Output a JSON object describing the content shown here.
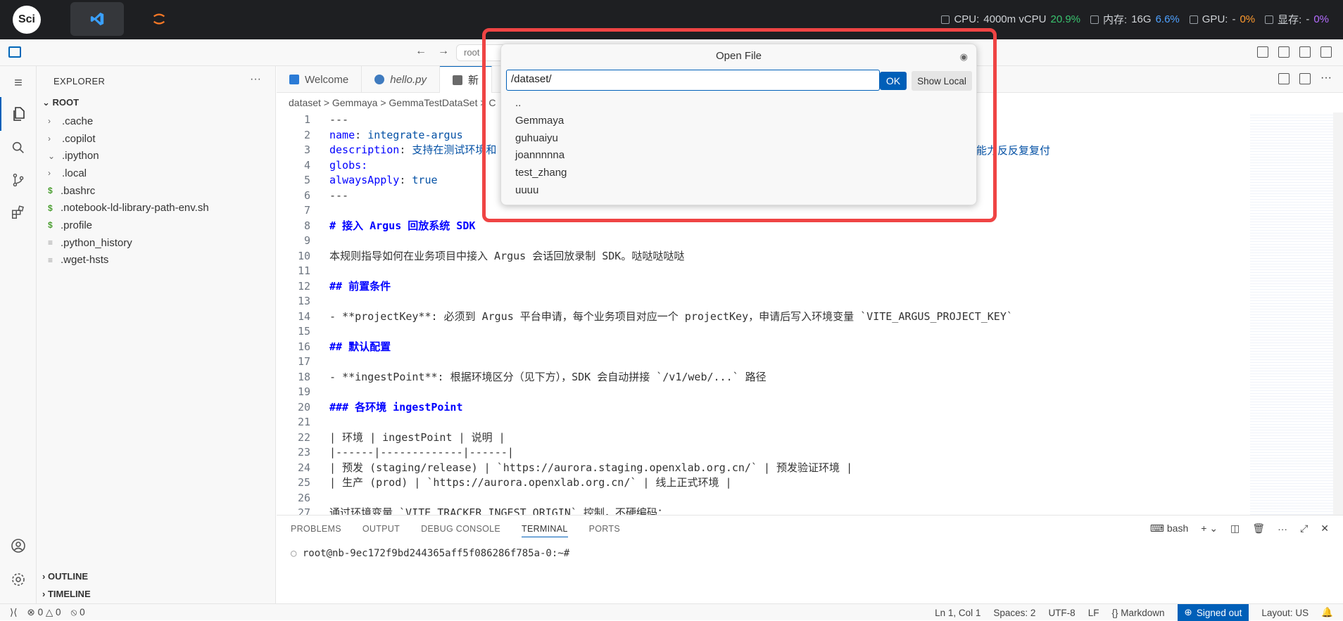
{
  "topbar": {
    "logo_text": "Sci",
    "stats": {
      "cpu_label": "CPU:",
      "cpu_value": "4000m vCPU",
      "cpu_percent": "20.9%",
      "mem_label": "内存:",
      "mem_value": "16G",
      "mem_percent": "6.6%",
      "gpu_label": "GPU:",
      "gpu_value": "-",
      "gpu_percent": "0%",
      "vram_label": "显存:",
      "vram_value": "-",
      "vram_percent": "0%"
    },
    "colors": {
      "green": "#39c26e",
      "blue": "#4ea1ff",
      "orange": "#ff9a2e",
      "purple": "#b46cff"
    }
  },
  "titlebar": {
    "command_center": "root"
  },
  "sidebar": {
    "title": "EXPLORER",
    "root": "ROOT",
    "items": [
      {
        "label": ".cache",
        "type": "folder",
        "twisty": "›"
      },
      {
        "label": ".copilot",
        "type": "folder",
        "twisty": "›"
      },
      {
        "label": ".ipython",
        "type": "folder",
        "twisty": "⌄"
      },
      {
        "label": ".local",
        "type": "folder",
        "twisty": "›"
      },
      {
        "label": ".bashrc",
        "type": "shell",
        "icon": "$"
      },
      {
        "label": ".notebook-ld-library-path-env.sh",
        "type": "shell",
        "icon": "$"
      },
      {
        "label": ".profile",
        "type": "shell",
        "icon": "$"
      },
      {
        "label": ".python_history",
        "type": "text",
        "icon": "≡"
      },
      {
        "label": ".wget-hsts",
        "type": "text",
        "icon": "≡"
      }
    ],
    "outline": "OUTLINE",
    "timeline": "TIMELINE"
  },
  "tabs": [
    {
      "label": "Welcome",
      "italic": false
    },
    {
      "label": "hello.py",
      "italic": true
    },
    {
      "label": "新",
      "italic": false
    }
  ],
  "breadcrumb": "dataset > Gemmaya > GemmaTestDataSet > C",
  "editor": {
    "lines": [
      "---",
      "name: integrate-argus",
      "description: 支持在测试环境和",
      "globs:",
      "alwaysApply: true",
      "---",
      "",
      "# 接入 Argus 回放系统 SDK",
      "",
      "本规则指导如何在业务项目中接入 Argus 会话回放录制 SDK。哒哒哒哒哒",
      "",
      "## 前置条件",
      "",
      "- **projectKey**: 必须到 Argus 平台申请，每个业务项目对应一个 projectKey，申请后写入环境变量 `VITE_ARGUS_PROJECT_KEY`",
      "",
      "## 默认配置",
      "",
      "- **ingestPoint**: 根据环境区分（见下方），SDK 会自动拼接 `/v1/web/...` 路径",
      "",
      "### 各环境 ingestPoint",
      "",
      "| 环境 | ingestPoint | 说明 |",
      "|------|-------------|------|",
      "| 预发 (staging/release) | `https://aurora.staging.openxlab.org.cn/` | 预发验证环境 |",
      "| 生产 (prod) | `https://aurora.openxlab.org.cn/` | 线上正式环境 |",
      "",
      "通过环境变量 `VITE_TRACKER_INGEST_ORIGIN` 控制，不硬编码："
    ],
    "line3_tail": "能力反反复复付"
  },
  "panel": {
    "tabs": [
      "PROBLEMS",
      "OUTPUT",
      "DEBUG CONSOLE",
      "TERMINAL",
      "PORTS"
    ],
    "shell": "bash",
    "prompt": "root@nb-9ec172f9bd244365aff5f086286f785a-0:~#"
  },
  "status": {
    "errors": "0",
    "warnings": "0",
    "ports": "0",
    "position": "Ln 1, Col 1",
    "spaces": "Spaces: 2",
    "encoding": "UTF-8",
    "eol": "LF",
    "language": "Markdown",
    "account": "Signed out",
    "layout": "Layout: US"
  },
  "dialog": {
    "title": "Open File",
    "path_value": "/dataset/",
    "ok_label": "OK",
    "show_local_label": "Show Local",
    "entries": [
      "..",
      "Gemmaya",
      "guhuaiyu",
      "joannnnna",
      "test_zhang",
      "uuuu"
    ]
  }
}
